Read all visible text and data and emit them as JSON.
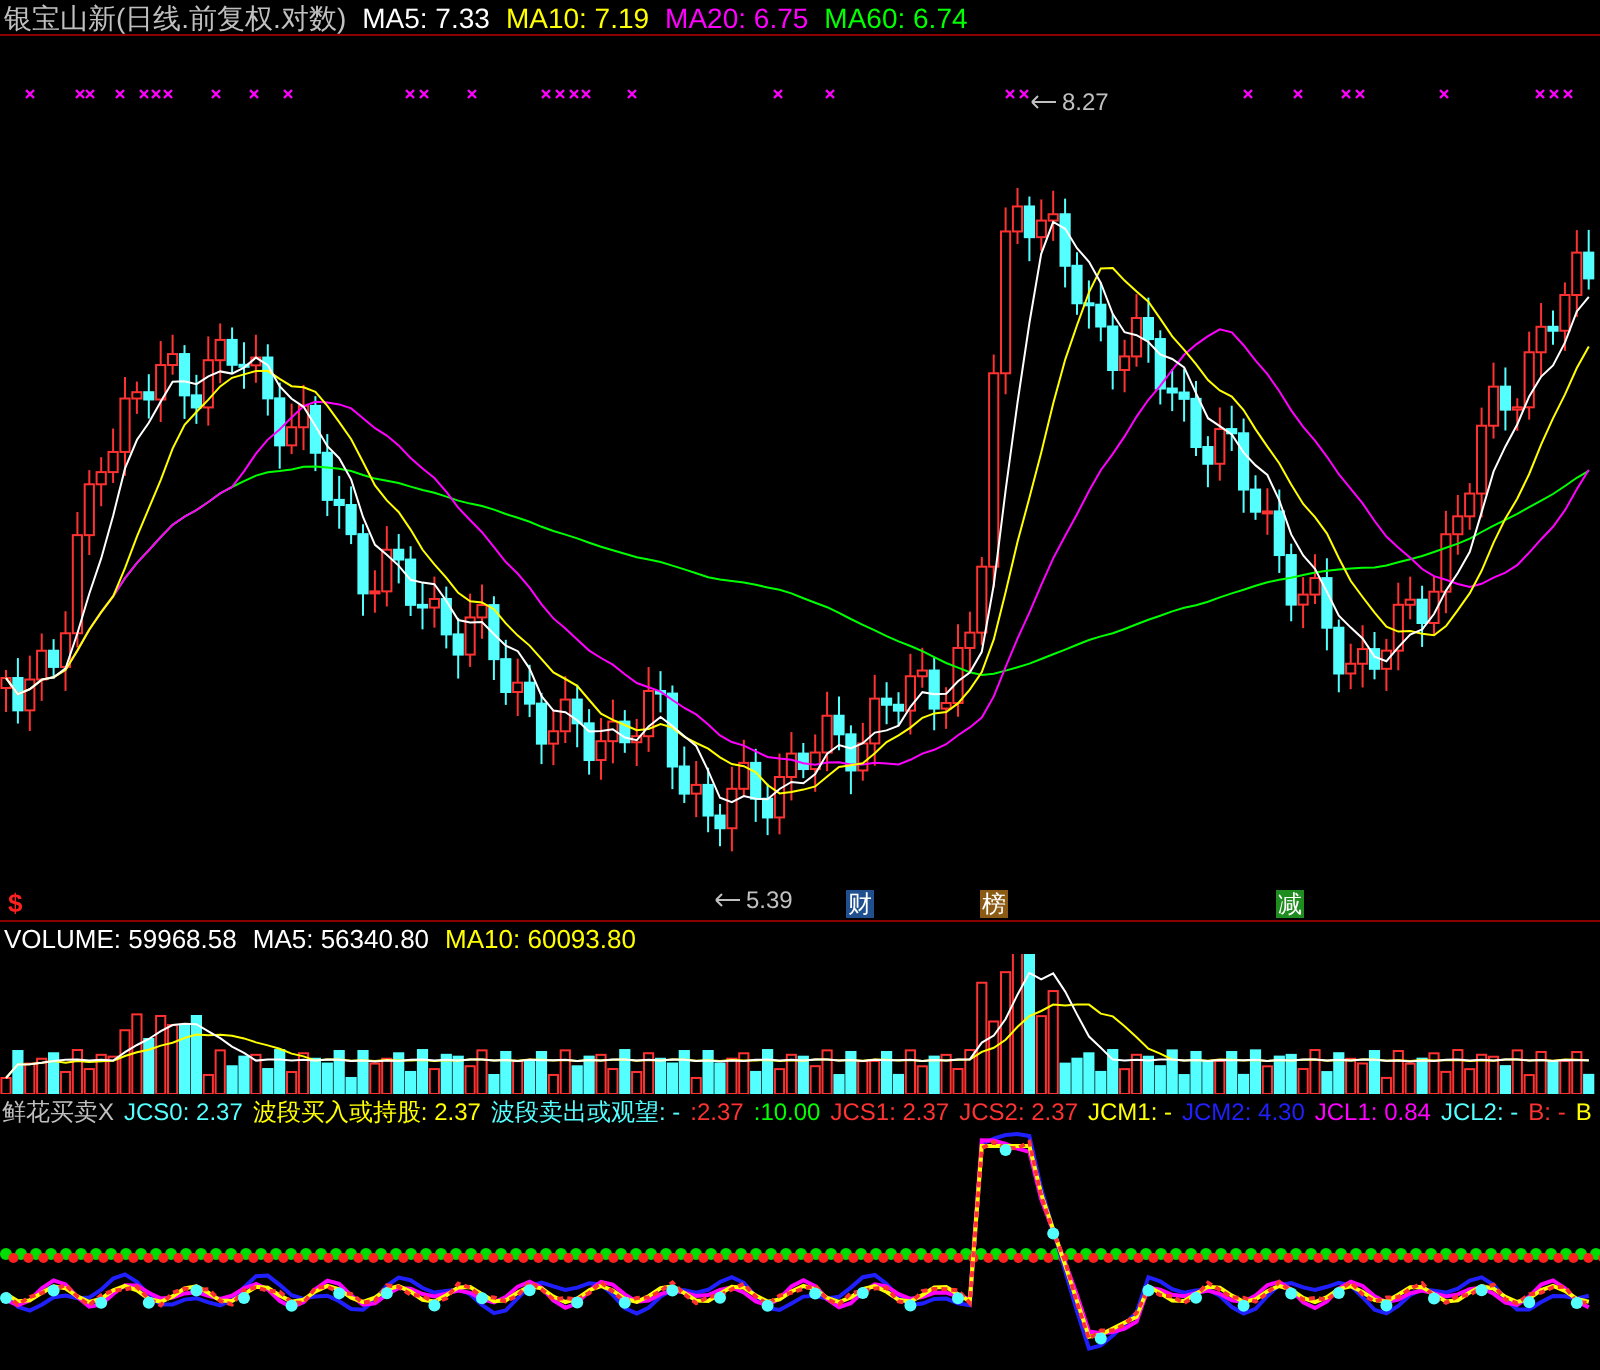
{
  "title": "银宝山新(日线.前复权.对数)",
  "main_legend": [
    {
      "label": "MA5:",
      "value": "7.33",
      "color": "#ffffff"
    },
    {
      "label": "MA10:",
      "value": "7.19",
      "color": "#ffff00"
    },
    {
      "label": "MA20:",
      "value": "6.75",
      "color": "#ff00ff"
    },
    {
      "label": "MA60:",
      "value": "6.74",
      "color": "#00ff00"
    }
  ],
  "price_labels": {
    "high": "8.27",
    "low": "5.39"
  },
  "marker": "$",
  "event_tags": [
    {
      "text": "财",
      "color": "#1f4f8f"
    },
    {
      "text": "榜",
      "color": "#8b5a14"
    },
    {
      "text": "减",
      "color": "#1e8c1e"
    }
  ],
  "volume_legend": [
    {
      "label": "VOLUME:",
      "value": "59968.58",
      "color": "#ffffff"
    },
    {
      "label": "MA5:",
      "value": "56340.80",
      "color": "#ffffff"
    },
    {
      "label": "MA10:",
      "value": "60093.80",
      "color": "#ffff00"
    }
  ],
  "indicator_title": "鲜花买卖X",
  "indicator_legend": [
    {
      "label": "JCS0:",
      "value": "2.37",
      "color": "#54ffff"
    },
    {
      "label": "波段买入或持股:",
      "value": "2.37",
      "color": "#ffff00"
    },
    {
      "label": "波段卖出或观望:",
      "value": "-",
      "color": "#54ffff"
    },
    {
      "label": ":",
      "value": "2.37",
      "color": "#ff3232"
    },
    {
      "label": ":",
      "value": "10.00",
      "color": "#00ff00"
    },
    {
      "label": "JCS1:",
      "value": "2.37",
      "color": "#ff3232"
    },
    {
      "label": "JCS2:",
      "value": "2.37",
      "color": "#ff3232"
    },
    {
      "label": "JCM1:",
      "value": "-",
      "color": "#ffff00"
    },
    {
      "label": "JCM2:",
      "value": "4.30",
      "color": "#2020ff"
    },
    {
      "label": "JCL1:",
      "value": "0.84",
      "color": "#ff00ff"
    },
    {
      "label": "JCL2:",
      "value": "-",
      "color": "#54ffff"
    },
    {
      "label": "B:",
      "value": "-",
      "color": "#ff3232"
    },
    {
      "label": "B",
      "color": "#ffff00"
    }
  ]
}
